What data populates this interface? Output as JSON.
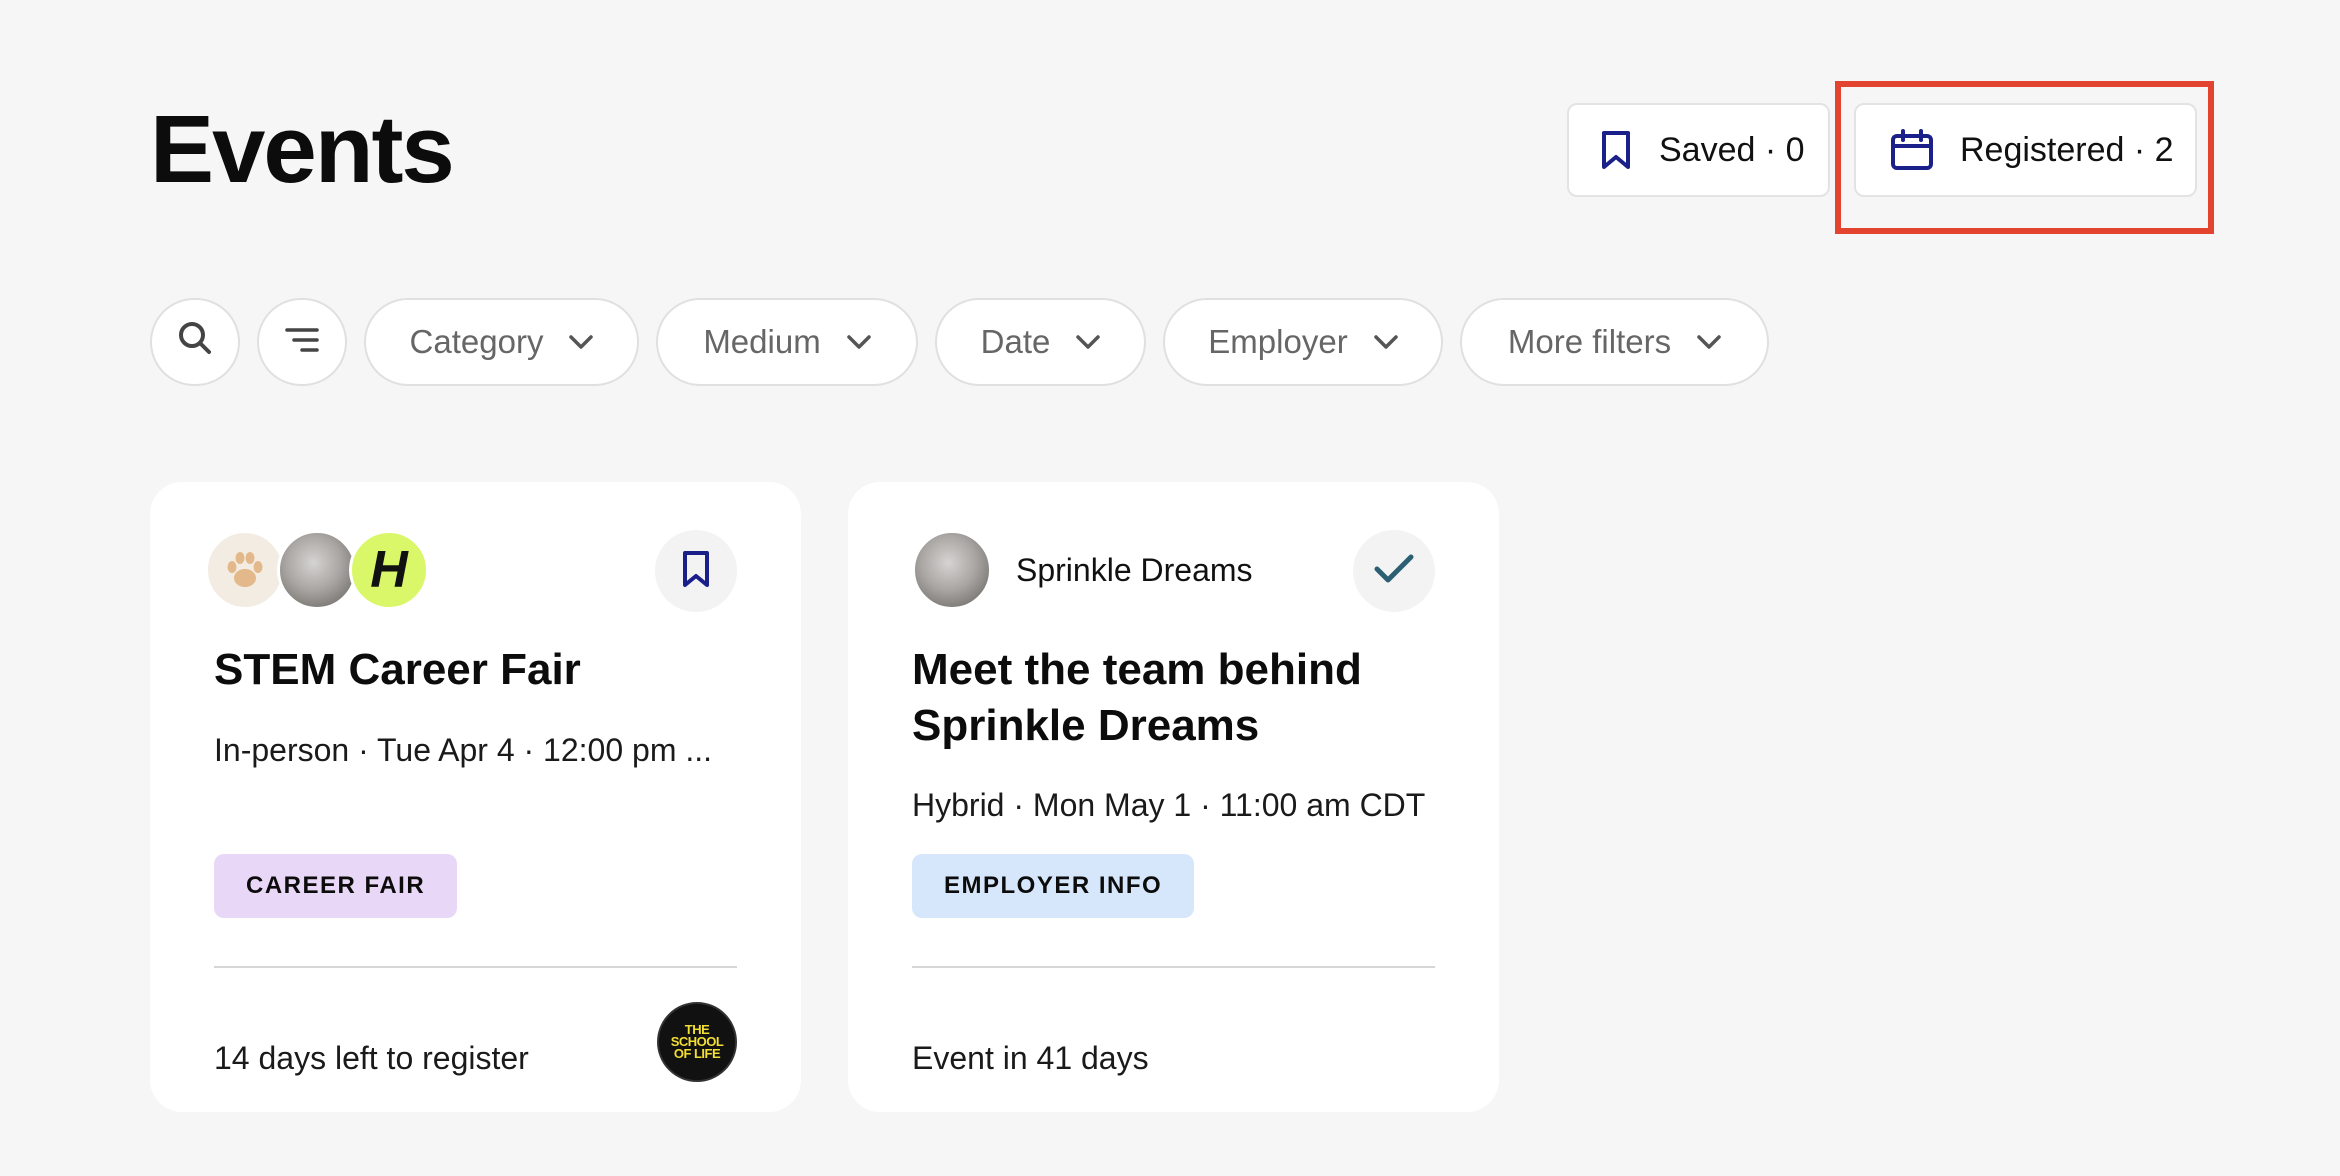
{
  "header": {
    "title": "Events",
    "saved_label": "Saved · 0",
    "registered_label": "Registered · 2"
  },
  "filters": {
    "category": "Category",
    "medium": "Medium",
    "date": "Date",
    "employer": "Employer",
    "more": "More filters"
  },
  "cards": [
    {
      "title": "STEM Career Fair",
      "meta": "In-person · Tue Apr 4 · 12:00 pm ...",
      "tag": "CAREER FAIR",
      "footer": "14 days left to register",
      "logo_text": "THE SCHOOL OF LIFE",
      "avatar_h": "H",
      "icons": [
        "paw-avatar-icon",
        "photo-avatar",
        "h-logo-avatar",
        "bookmark-icon",
        "school-of-life-logo"
      ]
    },
    {
      "employer": "Sprinkle Dreams",
      "title": "Meet the team behind Sprinkle Dreams",
      "meta": "Hybrid · Mon May 1 · 11:00 am CDT",
      "tag": "EMPLOYER INFO",
      "footer": "Event in 41 days",
      "icons": [
        "employer-avatar",
        "check-icon"
      ]
    }
  ],
  "colors": {
    "background": "#f6f6f6",
    "icon_navy": "#1b1f8a",
    "highlight": "#e2442f",
    "tag_purple": "#e8d7f6",
    "tag_blue": "#d6e6fb",
    "check_teal": "#2c5f73"
  }
}
